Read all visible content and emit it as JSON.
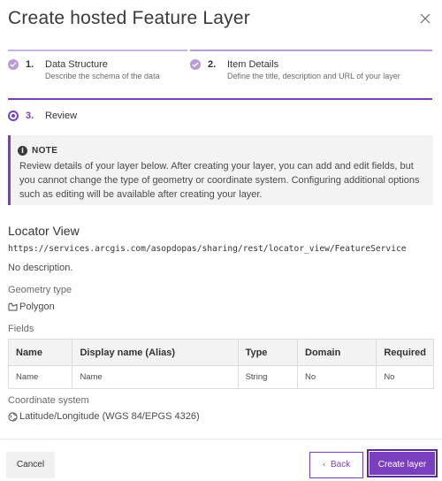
{
  "dialog": {
    "title": "Create hosted Feature Layer"
  },
  "steps": [
    {
      "number": "1.",
      "title": "Data Structure",
      "description": "Describe the schema of the data",
      "state": "complete"
    },
    {
      "number": "2.",
      "title": "Item Details",
      "description": "Define the title, description and URL of your layer",
      "state": "complete"
    },
    {
      "number": "3.",
      "title": "Review",
      "state": "active"
    }
  ],
  "notice": {
    "icon": "info-icon",
    "title": "NOTE",
    "body": "Review details of your layer below. After creating your layer, you can add and edit fields, but you cannot change the type of geometry or coordinate system. Configuring additional options such as editing will be available after creating your layer."
  },
  "layer": {
    "name": "Locator View",
    "url": "https://services.arcgis.com/asopdopas/sharing/rest/locator_view/FeatureService",
    "description": "No description."
  },
  "geometry": {
    "label": "Geometry type",
    "icon": "polygon-icon",
    "value": "Polygon"
  },
  "fields": {
    "label": "Fields",
    "columns": [
      "Name",
      "Display name (Alias)",
      "Type",
      "Domain",
      "Required"
    ],
    "rows": [
      [
        "Name",
        "Name",
        "String",
        "No",
        "No"
      ]
    ]
  },
  "coordinate_system": {
    "label": "Coordinate system",
    "icon": "globe-icon",
    "value": "Latitude/Longitude (WGS 84/EPGS 4326)"
  },
  "footer": {
    "cancel_label": "Cancel",
    "back_label": "Back",
    "create_label": "Create layer"
  },
  "colors": {
    "accent": "#7a3fbf",
    "step_complete": "#b79ad6"
  }
}
